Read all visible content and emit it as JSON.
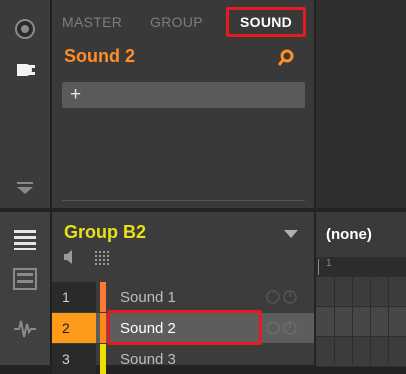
{
  "tabs": {
    "master": "MASTER",
    "group": "GROUP",
    "sound": "SOUND"
  },
  "sound_title": "Sound 2",
  "plugin_slot": {
    "add_label": "+"
  },
  "group": {
    "title": "Group B2"
  },
  "sounds": [
    {
      "num": "1",
      "label": "Sound 1",
      "color": "#ff7a3a"
    },
    {
      "num": "2",
      "label": "Sound 2",
      "color": "#ff8c1a"
    },
    {
      "num": "3",
      "label": "Sound 3",
      "color": "#f0e000"
    }
  ],
  "pattern": {
    "name": "(none)",
    "ruler_start": "1"
  },
  "colors": {
    "accent_orange": "#ff8e28",
    "group_yellow": "#e6e11a",
    "highlight_red": "#e31b23"
  },
  "icons": [
    "volume-knob-icon",
    "plugin-plug-icon",
    "collapse-arrow-icon",
    "list-view-icon",
    "mixer-view-icon",
    "waveform-icon",
    "magnifier-icon",
    "dropdown-arrow-icon",
    "speaker-icon",
    "keyboard-grid-icon",
    "power-icon"
  ]
}
